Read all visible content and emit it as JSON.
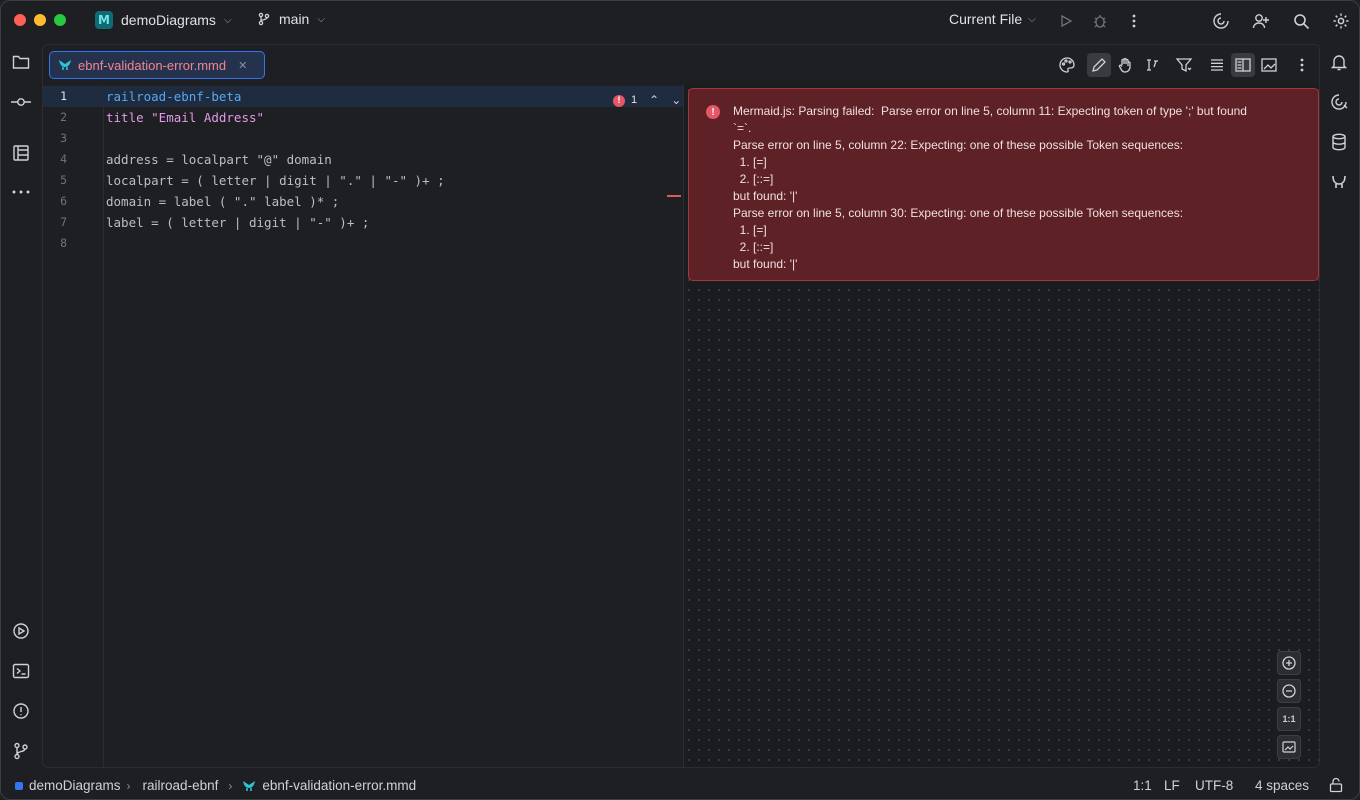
{
  "titlebar": {
    "project": "demoDiagrams",
    "branch": "main",
    "run_config": "Current File"
  },
  "tab": {
    "label": "ebnf-validation-error.mmd"
  },
  "editor": {
    "lines": [
      {
        "num": "1",
        "text": "railroad-ebnf-beta"
      },
      {
        "num": "2",
        "text": "title \"Email Address\""
      },
      {
        "num": "3",
        "text": ""
      },
      {
        "num": "4",
        "text": "address = localpart \"@\" domain"
      },
      {
        "num": "5",
        "text": "localpart = ( letter | digit | \".\" | \"-\" )+ ;"
      },
      {
        "num": "6",
        "text": "domain = label ( \".\" label )* ;"
      },
      {
        "num": "7",
        "text": "label = ( letter | digit | \"-\" )+ ;"
      },
      {
        "num": "8",
        "text": ""
      }
    ],
    "error_count": "1"
  },
  "preview": {
    "error_lines": [
      "Mermaid.js: Parsing failed:  Parse error on line 5, column 11: Expecting token of type ';' but found",
      "`=`.",
      "Parse error on line 5, column 22: Expecting: one of these possible Token sequences:",
      "  1. [=]",
      "  2. [::=]",
      "but found: '|'",
      "Parse error on line 5, column 30: Expecting: one of these possible Token sequences:",
      "  1. [=]",
      "  2. [::=]",
      "but found: '|'"
    ],
    "zoom_reset_label": "1:1"
  },
  "statusbar": {
    "crumbs": [
      "demoDiagrams",
      "railroad-ebnf",
      "ebnf-validation-error.mmd"
    ],
    "position": "1:1",
    "line_sep": "LF",
    "encoding": "UTF-8",
    "indent": "4 spaces"
  },
  "colors": {
    "accent": "#3574f0",
    "error": "#e55765",
    "error_bg": "#5e2126",
    "mermaid": "#2cc5d1"
  }
}
